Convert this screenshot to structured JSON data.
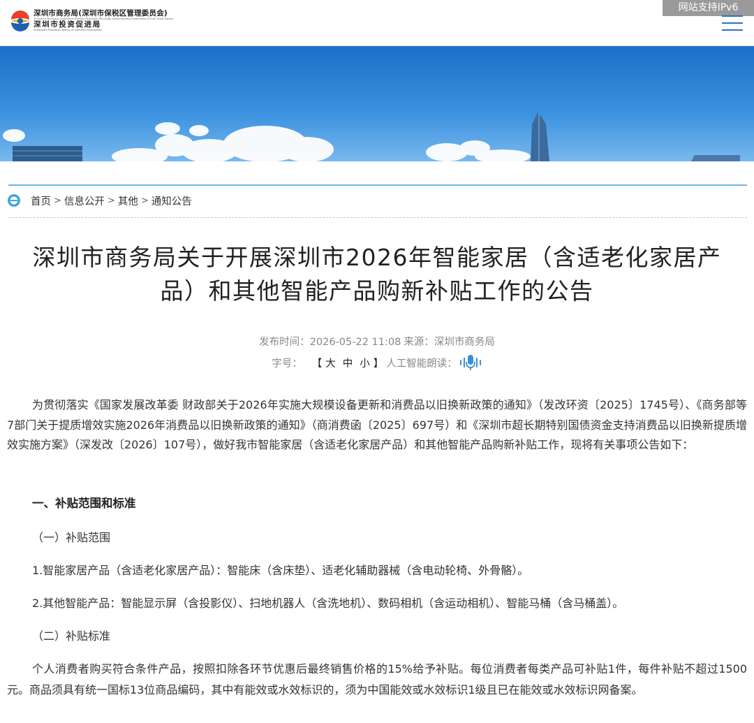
{
  "header": {
    "logo_line1": "深圳市商务局(深圳市保税区管理委员会)",
    "logo_sub1": "Shenzhen Municipal Commerce Bureau (Shenzhen Municipal Administrative Committee of Free Trade Zones)",
    "logo_line2": "深圳市投资促进局",
    "logo_sub2": "Investment Promotion Agency of Shenzhen Municipality",
    "ipv6_label": "网站支持IPv6",
    "menu_icon": "hamburger-menu-icon"
  },
  "breadcrumb": {
    "icon": "home-circle-icon",
    "items": [
      "首页",
      "信息公开",
      "其他",
      "通知公告"
    ],
    "separator": ">"
  },
  "article": {
    "title": "深圳市商务局关于开展深圳市2026年智能家居（含适老化家居产品）和其他智能产品购新补贴工作的公告",
    "publish_label": "发布时间：",
    "publish_time": "2026-05-22 11:08",
    "source_label": "来源：",
    "source": "深圳市商务局",
    "fontsize_label": "字号：",
    "fontsize_open": "【",
    "fontsize_large": "大",
    "fontsize_medium": "中",
    "fontsize_small": "小",
    "fontsize_close": "】",
    "tts_label": "人工智能朗读：",
    "tts_icon": "microphone-icon",
    "intro": "为贯彻落实《国家发展改革委 财政部关于2026年实施大规模设备更新和消费品以旧换新政策的通知》（发改环资〔2025〕1745号）、《商务部等7部门关于提质增效实施2026年消费品以旧换新政策的通知》（商消费函〔2025〕697号）和《深圳市超长期特别国债资金支持消费品以旧换新提质增效实施方案》（深发改〔2026〕107号），做好我市智能家居（含适老化家居产品）和其他智能产品购新补贴工作，现将有关事项公告如下：",
    "section1": "一、补贴范围和标准",
    "sub1": "（一）补贴范围",
    "item1": "1.智能家居产品（含适老化家居产品）：智能床（含床垫）、适老化辅助器械（含电动轮椅、外骨骼）。",
    "item2": "2.其他智能产品：智能显示屏（含投影仪）、扫地机器人（含洗地机）、数码相机（含运动相机）、智能马桶（含马桶盖）。",
    "sub2": "（二）补贴标准",
    "standard": "个人消费者购买符合条件产品，按照扣除各环节优惠后最终销售价格的15%给予补贴。每位消费者每类产品可补贴1件，每件补贴不超过1500元。商品须具有统一国标13位商品编码，其中有能效或水效标识的，须为中国能效或水效标识1级且已在能效或水效标识网备案。"
  }
}
